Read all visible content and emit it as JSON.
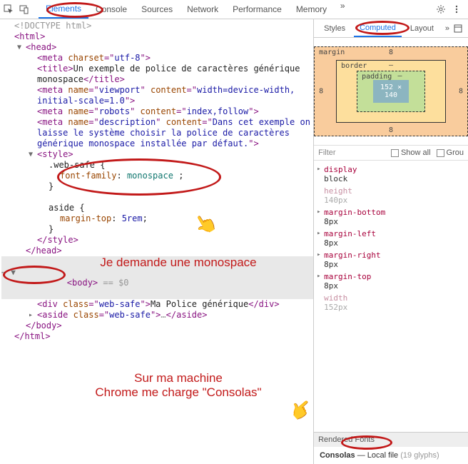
{
  "toolbar": {
    "tabs": [
      "Elements",
      "Console",
      "Sources",
      "Network",
      "Performance",
      "Memory"
    ]
  },
  "subtabs": {
    "tabs": [
      "Styles",
      "Computed",
      "Layout"
    ]
  },
  "dom": {
    "doctype": "<!DOCTYPE html>",
    "html_open": "<html>",
    "head_open": "<head>",
    "meta_charset_a": "charset",
    "meta_charset_v": "utf-8",
    "title_text": "Un exemple de police de caractères générique monospace",
    "meta_viewport_name": "viewport",
    "meta_viewport_content": "width=device-width, initial-scale=1.0",
    "meta_robots_name": "robots",
    "meta_robots_content": "index,follow",
    "meta_desc_name": "description",
    "meta_desc_content": "Dans cet exemple on laisse le système choisir la police de caractères générique monospace installée par défaut.",
    "style_open": "<style>",
    "css_rule1_sel": ".web-safe {",
    "css_rule1_prop": "font-family",
    "css_rule1_val": "monospace",
    "css_rule1_close": "}",
    "css_rule2_sel": "aside {",
    "css_rule2_prop": "margin-top",
    "css_rule2_val": "5rem",
    "css_rule2_close": "}",
    "style_close": "</style>",
    "head_close": "</head>",
    "body_sel_suffix": "== $0",
    "div_class": "web-safe",
    "div_text": "Ma Police générique",
    "aside_class": "web-safe",
    "body_close": "</body>",
    "html_close": "</html>"
  },
  "boxmodel": {
    "margin_label": "margin",
    "border_label": "border",
    "padding_label": "padding",
    "margin_top": "8",
    "margin_right": "8",
    "margin_bottom": "8",
    "margin_left": "8",
    "border_all": "–",
    "padding_all": "–",
    "content": "152 × 140"
  },
  "filter": {
    "placeholder": "Filter",
    "show_all": "Show all",
    "group": "Grou"
  },
  "computed": [
    {
      "name": "display",
      "value": "block",
      "dim": false
    },
    {
      "name": "height",
      "value": "140px",
      "dim": true
    },
    {
      "name": "margin-bottom",
      "value": "8px",
      "dim": false
    },
    {
      "name": "margin-left",
      "value": "8px",
      "dim": false
    },
    {
      "name": "margin-right",
      "value": "8px",
      "dim": false
    },
    {
      "name": "margin-top",
      "value": "8px",
      "dim": false
    },
    {
      "name": "width",
      "value": "152px",
      "dim": true
    }
  ],
  "rendered_fonts": {
    "header": "Rendered Fonts",
    "name": "Consolas",
    "source": "Local file",
    "glyphs": "(19 glyphs)"
  },
  "annotations": {
    "callout1": "Je demande une monospace",
    "callout2_l1": "Sur ma machine",
    "callout2_l2": "Chrome me charge \"Consolas\""
  }
}
